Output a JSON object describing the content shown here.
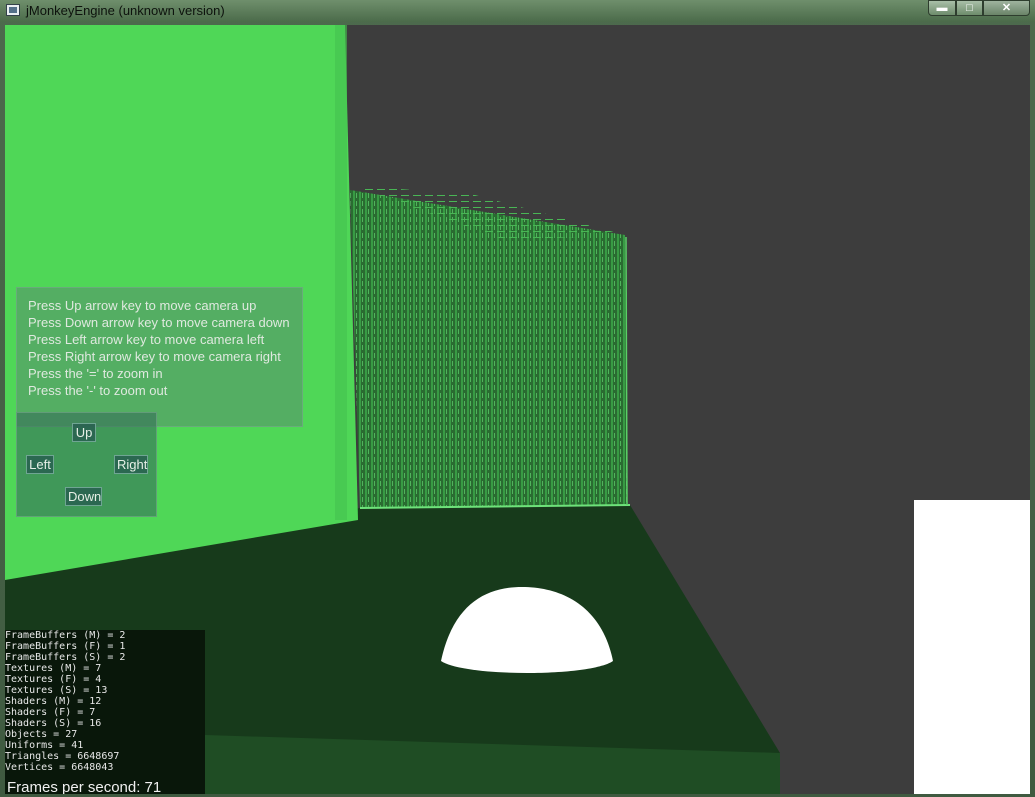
{
  "window": {
    "title": "jMonkeyEngine (unknown version)",
    "controls": {
      "minimize": "▬",
      "maximize": "□",
      "close": "✕"
    },
    "colors": {
      "green_wall": "#4fd757",
      "floor": "#173a1b",
      "gray_wall": "#3d3d3d",
      "panel": "#5a8c6e"
    }
  },
  "instructions": [
    "Press Up arrow key to move camera up",
    "Press Down arrow key to move camera down",
    "Press Left arrow key to move camera left",
    "Press Right arrow key to move camera right",
    "Press the '=' to zoom in",
    "Press the '-' to zoom out"
  ],
  "dpad": {
    "up": "Up",
    "left": "Left",
    "right": "Right",
    "down": "Down"
  },
  "stats": [
    "FrameBuffers (M) = 2",
    "FrameBuffers (F) = 1",
    "FrameBuffers (S) = 2",
    "Textures (M) = 7",
    "Textures (F) = 4",
    "Textures (S) = 13",
    "Shaders (M) = 12",
    "Shaders (F) = 7",
    "Shaders (S) = 16",
    "Objects = 27",
    "Uniforms = 41",
    "Triangles = 6648697",
    "Vertices = 6648043"
  ],
  "fps": "Frames per second: 71"
}
